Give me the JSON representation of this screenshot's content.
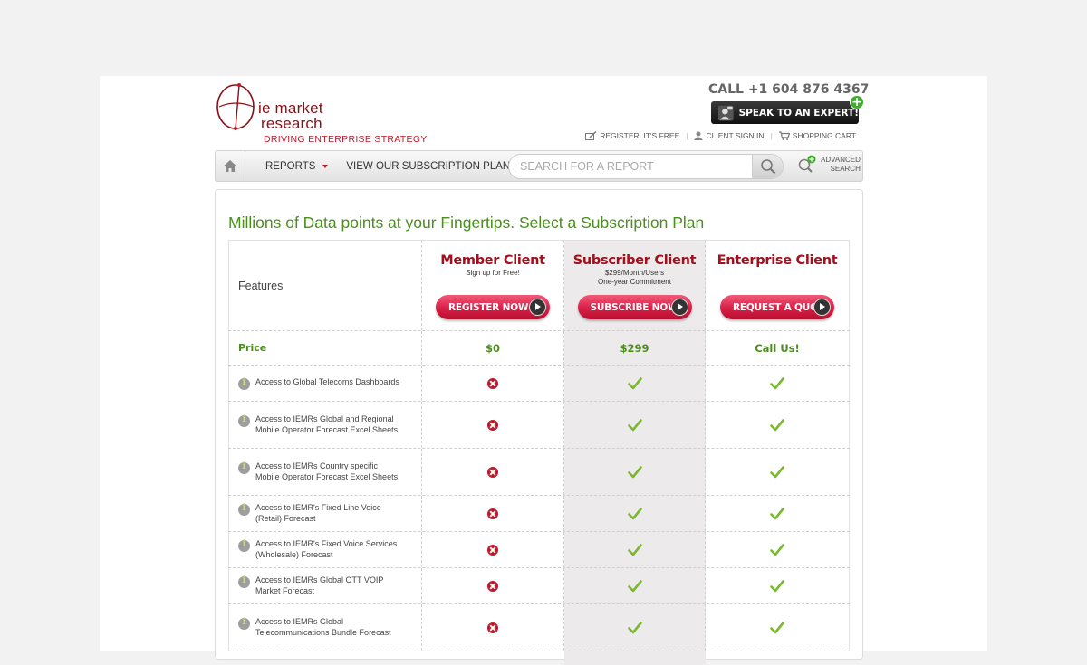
{
  "header": {
    "logo_line1": "ie market",
    "logo_line2": "research",
    "tagline": "DRIVING ENTERPRISE STRATEGY",
    "phone": "CALL +1 604 876 4367",
    "expert_button": "SPEAK TO AN EXPERT!",
    "links": {
      "register": "REGISTER. IT'S FREE",
      "signin": "CLIENT SIGN IN",
      "cart": "SHOPPING CART"
    }
  },
  "nav": {
    "reports": "REPORTS",
    "plans": "VIEW OUR SUBSCRIPTION PLANS",
    "search_placeholder": "SEARCH FOR A REPORT",
    "advanced_line1": "ADVANCED",
    "advanced_line2": "SEARCH"
  },
  "main": {
    "title": "Millions of Data points at your Fingertips. Select a Subscription Plan",
    "features_label": "Features",
    "plans": [
      {
        "name": "Member Client",
        "sub1": "Sign up for Free!",
        "sub2": "",
        "button": "REGISTER NOW",
        "price": "$0"
      },
      {
        "name": "Subscriber Client",
        "sub1": "$299/Month/Users",
        "sub2": "One-year Commitment",
        "button": "SUBSCRIBE NOW",
        "price": "$299"
      },
      {
        "name": "Enterprise Client",
        "sub1": "",
        "sub2": "",
        "button": "REQUEST A QUOTE",
        "price": "Call Us!"
      }
    ],
    "price_label": "Price",
    "features": [
      {
        "text": "Access to Global Telecoms Dashboards",
        "member": false,
        "subscriber": true,
        "enterprise": true
      },
      {
        "text": "Access to IEMRs Global and Regional Mobile Operator Forecast Excel Sheets",
        "member": false,
        "subscriber": true,
        "enterprise": true
      },
      {
        "text": "Access to IEMRs Country specific Mobile Operator Forecast Excel Sheets",
        "member": false,
        "subscriber": true,
        "enterprise": true
      },
      {
        "text": "Access to IEMR's Fixed Line Voice (Retail) Forecast",
        "member": false,
        "subscriber": true,
        "enterprise": true
      },
      {
        "text": "Access to IEMR's Fixed Voice Services (Wholesale) Forecast",
        "member": false,
        "subscriber": true,
        "enterprise": true
      },
      {
        "text": "Access to IEMRs Global OTT VOIP Market Forecast",
        "member": false,
        "subscriber": true,
        "enterprise": true
      },
      {
        "text": "Access to IEMRs Global Telecommunications Bundle Forecast",
        "member": false,
        "subscriber": true,
        "enterprise": true
      }
    ]
  },
  "colors": {
    "brand_red": "#a3101c",
    "accent_green": "#4a8f1c",
    "button_pink": "#d81e47"
  }
}
